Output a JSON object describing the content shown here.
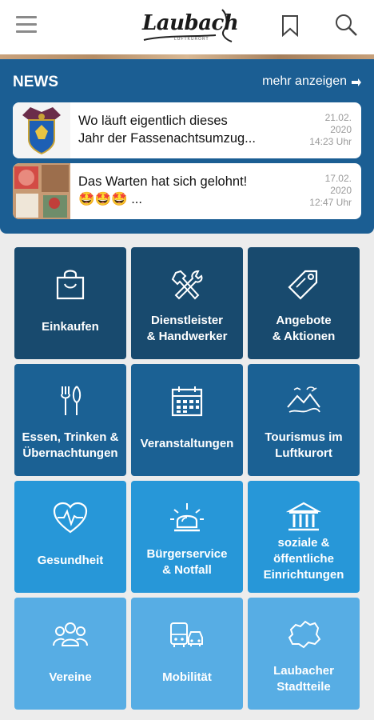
{
  "header": {
    "logo_text": "Laubach",
    "logo_subtext": "LUFTKURORT",
    "menu_icon": "hamburger-menu-icon",
    "bookmark_icon": "bookmark-icon",
    "search_icon": "search-icon"
  },
  "news": {
    "title": "NEWS",
    "more_label": "mehr anzeigen",
    "items": [
      {
        "line1": "Wo läuft eigentlich dieses",
        "line2": "Jahr der Fassenachtsumzug...",
        "date": "21.02.",
        "year": "2020",
        "time": "14:23 Uhr"
      },
      {
        "line1": "Das Warten hat sich gelohnt!",
        "line2": "🤩🤩🤩 ...",
        "date": "17.02.",
        "year": "2020",
        "time": "12:47 Uhr"
      }
    ]
  },
  "tiles": [
    {
      "lines": [
        "Einkaufen"
      ],
      "icon": "shopping-bag-icon"
    },
    {
      "lines": [
        "Dienstleister",
        "& Handwerker"
      ],
      "icon": "tools-icon"
    },
    {
      "lines": [
        "Angebote",
        "& Aktionen"
      ],
      "icon": "tag-icon"
    },
    {
      "lines": [
        "Essen, Trinken &",
        "Übernachtungen"
      ],
      "icon": "cutlery-icon"
    },
    {
      "lines": [
        "Veranstaltungen"
      ],
      "icon": "calendar-icon"
    },
    {
      "lines": [
        "Tourismus im",
        "Luftkurort"
      ],
      "icon": "landscape-icon"
    },
    {
      "lines": [
        "Gesundheit"
      ],
      "icon": "heartbeat-icon"
    },
    {
      "lines": [
        "Bürgerservice",
        "& Notfall"
      ],
      "icon": "alarm-light-icon"
    },
    {
      "lines": [
        "soziale &",
        "öffentliche",
        "Einrichtungen"
      ],
      "icon": "public-building-icon"
    },
    {
      "lines": [
        "Vereine"
      ],
      "icon": "group-icon"
    },
    {
      "lines": [
        "Mobilität"
      ],
      "icon": "vehicles-icon"
    },
    {
      "lines": [
        "Laubacher",
        "Stadtteile"
      ],
      "icon": "district-map-icon"
    }
  ],
  "colors": {
    "news_bg": "#1b5e93",
    "row1": "#184a6e",
    "row2": "#1b6194",
    "row3": "#2797d8",
    "row4": "#57ade4"
  }
}
